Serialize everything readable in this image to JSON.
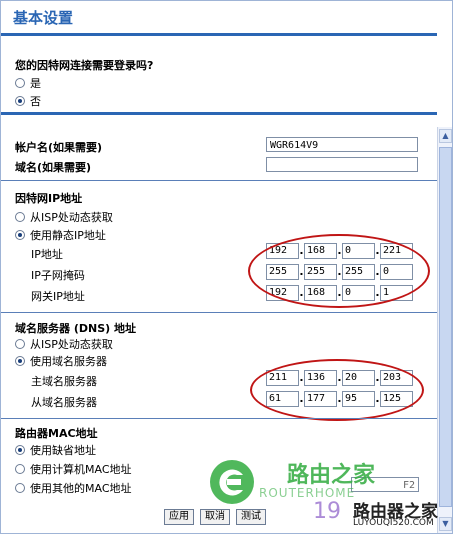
{
  "page_title": "基本设置",
  "login": {
    "question": "您的因特网连接需要登录吗?",
    "options": [
      {
        "label": "是",
        "selected": false
      },
      {
        "label": "否",
        "selected": true
      }
    ]
  },
  "account": {
    "account_name_label": "帐户名(如果需要)",
    "account_name_value": "WGR614V9",
    "domain_name_label": "域名(如果需要)",
    "domain_name_value": ""
  },
  "internet_ip": {
    "heading": "因特网IP地址",
    "options": [
      {
        "label": "从ISP处动态获取",
        "selected": false
      },
      {
        "label": "使用静态IP地址",
        "selected": true
      }
    ],
    "fields": [
      {
        "label": "IP地址",
        "octets": [
          "192",
          "168",
          "0",
          "221"
        ]
      },
      {
        "label": "IP子网掩码",
        "octets": [
          "255",
          "255",
          "255",
          "0"
        ]
      },
      {
        "label": "网关IP地址",
        "octets": [
          "192",
          "168",
          "0",
          "1"
        ]
      }
    ]
  },
  "dns": {
    "heading": "域名服务器 (DNS) 地址",
    "options": [
      {
        "label": "从ISP处动态获取",
        "selected": false
      },
      {
        "label": "使用域名服务器",
        "selected": true
      }
    ],
    "fields": [
      {
        "label": "主域名服务器",
        "octets": [
          "211",
          "136",
          "20",
          "203"
        ]
      },
      {
        "label": "从域名服务器",
        "octets": [
          "61",
          "177",
          "95",
          "125"
        ]
      }
    ]
  },
  "mac": {
    "heading": "路由器MAC地址",
    "options": [
      {
        "label": "使用缺省地址",
        "selected": true
      },
      {
        "label": "使用计算机MAC地址",
        "selected": false
      },
      {
        "label": "使用其他的MAC地址",
        "selected": false
      }
    ],
    "mac_field_value": "F2"
  },
  "buttons": {
    "apply": "应用",
    "cancel": "取消",
    "test": "测试"
  },
  "watermark": {
    "cn_text": "路由之家",
    "en_text": "ROUTERHOME",
    "ip_fragment": "19",
    "logo_text": "路由器之家",
    "url_text": "LUYOUQI520.COM",
    "colors": {
      "green": "#3db04a",
      "dark": "#222222"
    }
  },
  "colors": {
    "title_blue": "#2a66b4",
    "annotation_red": "#c01515"
  }
}
